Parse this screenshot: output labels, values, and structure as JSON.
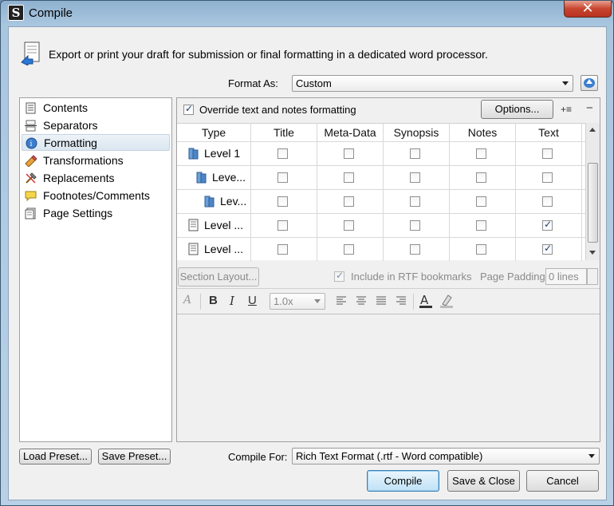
{
  "window": {
    "title": "Compile",
    "close_glyph": "✕"
  },
  "intro": "Export or print your draft for submission or final formatting in a dedicated word processor.",
  "format_as": {
    "label": "Format As:",
    "value": "Custom"
  },
  "sidebar": {
    "items": [
      {
        "label": "Contents",
        "icon": "contents-icon"
      },
      {
        "label": "Separators",
        "icon": "separators-icon"
      },
      {
        "label": "Formatting",
        "icon": "formatting-icon",
        "selected": true
      },
      {
        "label": "Transformations",
        "icon": "transformations-icon"
      },
      {
        "label": "Replacements",
        "icon": "replacements-icon"
      },
      {
        "label": "Footnotes/Comments",
        "icon": "footnotes-icon"
      },
      {
        "label": "Page Settings",
        "icon": "page-settings-icon"
      }
    ]
  },
  "override": {
    "label": "Override text and notes formatting",
    "checked": true
  },
  "options_button": "Options...",
  "add_level_glyph": "+≡",
  "remove_level_glyph": "−",
  "table": {
    "columns": [
      "Type",
      "Title",
      "Meta-Data",
      "Synopsis",
      "Notes",
      "Text"
    ],
    "rows": [
      {
        "type": "Level 1",
        "icon": "folder-icon",
        "checks": [
          false,
          false,
          false,
          false,
          false
        ]
      },
      {
        "type": "Leve...",
        "icon": "folder-icon",
        "checks": [
          false,
          false,
          false,
          false,
          false
        ]
      },
      {
        "type": "Lev...",
        "icon": "folder-icon",
        "checks": [
          false,
          false,
          false,
          false,
          false
        ]
      },
      {
        "type": "Level ...",
        "icon": "document-icon",
        "checks": [
          false,
          false,
          false,
          false,
          true
        ]
      },
      {
        "type": "Level ...",
        "icon": "document-icon",
        "checks": [
          false,
          false,
          false,
          false,
          true
        ]
      }
    ]
  },
  "section_layout_button": "Section Layout...",
  "rtf_bookmarks": {
    "label": "Include in RTF bookmarks",
    "checked": true
  },
  "page_padding": {
    "label": "Page Padding:",
    "value": "0 lines"
  },
  "format_bar": {
    "bold": "B",
    "italic": "I",
    "underline": "U",
    "line_spacing": "1.0x"
  },
  "load_preset": "Load Preset...",
  "save_preset": "Save Preset...",
  "compile_for": {
    "label": "Compile For:",
    "value": "Rich Text Format (.rtf - Word compatible)"
  },
  "buttons": {
    "compile": "Compile",
    "save_close": "Save & Close",
    "cancel": "Cancel"
  }
}
